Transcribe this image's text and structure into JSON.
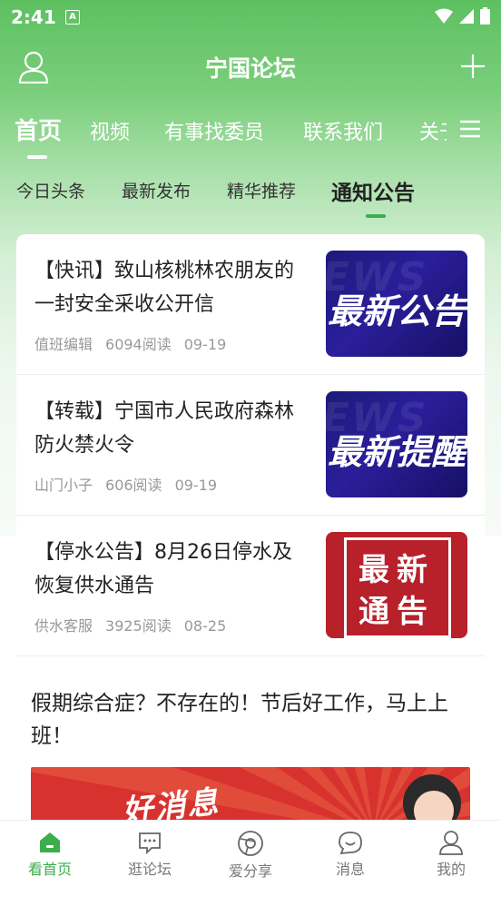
{
  "status_bar": {
    "time": "2:41",
    "notification_letter": "A"
  },
  "header": {
    "title": "宁国论坛"
  },
  "main_tabs": [
    "首页",
    "视频",
    "有事找委员",
    "联系我们",
    "关于"
  ],
  "sub_tabs": [
    "今日头条",
    "最新发布",
    "精华推荐",
    "通知公告"
  ],
  "news": [
    {
      "title": "【快讯】致山核桃林农朋友的一封安全采收公开信",
      "author": "值班编辑",
      "reads": "6094阅读",
      "date": "09-19",
      "thumb_text": "最新公告",
      "thumb_bg": "EWS"
    },
    {
      "title": "【转载】宁国市人民政府森林防火禁火令",
      "author": "山门小子",
      "reads": "606阅读",
      "date": "09-19",
      "thumb_text": "最新提醒",
      "thumb_bg": "EWS"
    },
    {
      "title": "【停水公告】8月26日停水及恢复供水通告",
      "author": "供水客服",
      "reads": "3925阅读",
      "date": "08-25",
      "thumb_line1": "最新",
      "thumb_line2": "通告"
    }
  ],
  "article": {
    "title": "假期综合症？不存在的！节后好工作，马上上班！",
    "banner_text": "好消息"
  },
  "bottom_nav": [
    {
      "label": "看首页",
      "icon": "home-icon",
      "active": true
    },
    {
      "label": "逛论坛",
      "icon": "chat-icon",
      "active": false
    },
    {
      "label": "爱分享",
      "icon": "share-icon",
      "active": false
    },
    {
      "label": "消息",
      "icon": "message-icon",
      "active": false
    },
    {
      "label": "我的",
      "icon": "profile-icon",
      "active": false
    }
  ],
  "colors": {
    "accent": "#3dae4b",
    "header_green": "#5dc060"
  }
}
